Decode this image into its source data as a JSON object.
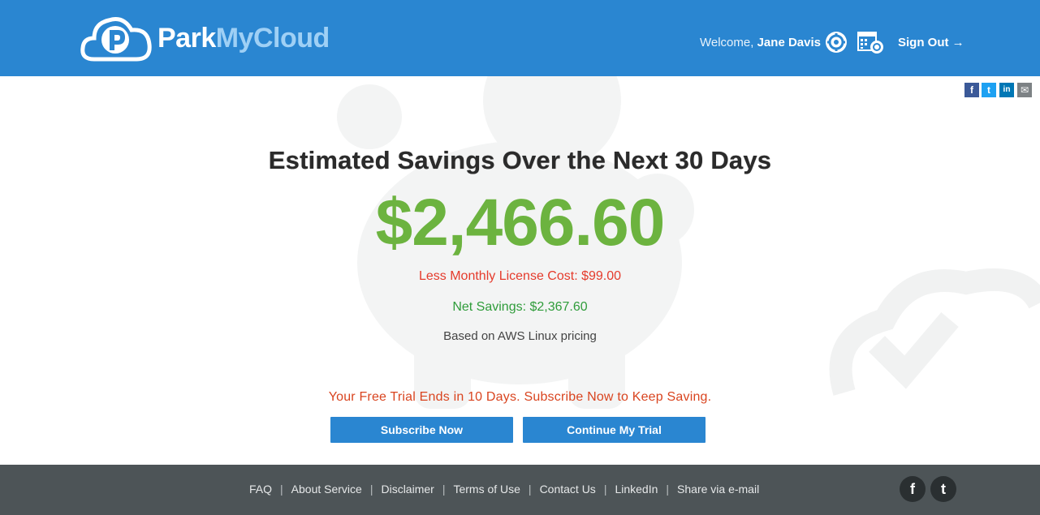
{
  "header": {
    "logo_park": "Park",
    "logo_mycloud": "MyCloud",
    "welcome_prefix": "Welcome,",
    "user_name": "Jane Davis",
    "settings_icon": "gear-icon",
    "schedule_icon": "calendar-gear-icon",
    "signout_label": "Sign Out",
    "signout_arrow": "→"
  },
  "share": {
    "facebook": "f",
    "twitter": "t",
    "linkedin": "in",
    "email": "✉"
  },
  "main": {
    "title": "Estimated Savings Over the Next 30 Days",
    "amount": "$2,466.60",
    "license": "Less Monthly License Cost: $99.00",
    "net": "Net Savings: $2,367.60",
    "basis": "Based on AWS Linux pricing",
    "trial_notice": "Your Free Trial Ends in 10 Days. Subscribe Now to Keep Saving.",
    "subscribe_label": "Subscribe Now",
    "continue_label": "Continue My Trial"
  },
  "footer": {
    "links": [
      "FAQ",
      "About Service",
      "Disclaimer",
      "Terms of Use",
      "Contact Us",
      "LinkedIn",
      "Share via e-mail"
    ],
    "separator": "|",
    "facebook": "f",
    "twitter": "t"
  },
  "colors": {
    "brand_blue": "#2a86d1",
    "savings_green": "#6cb33f",
    "license_red": "#e53b2c",
    "net_green": "#2f9c3a",
    "trial_orange": "#d9441f",
    "footer_bg": "#4d5457"
  }
}
